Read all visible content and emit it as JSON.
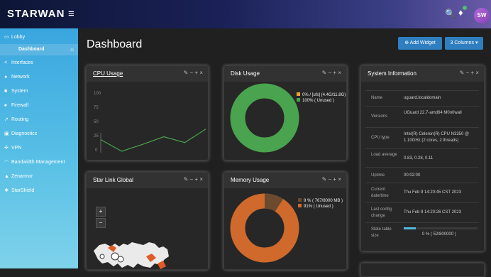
{
  "brand": {
    "name": "STARWAN",
    "avatar_initials": "SW",
    "hamburger_icon": "menu-icon",
    "search_icon": "search-icon",
    "bell_icon": "bell-icon"
  },
  "sidebar": {
    "items": [
      {
        "label": "Lobby",
        "icon": "monitor-icon"
      },
      {
        "label": "Dashboard",
        "icon": "home-icon"
      },
      {
        "label": "Interfaces",
        "icon": "share-icon"
      },
      {
        "label": "Network",
        "icon": "globe-icon"
      },
      {
        "label": "System",
        "icon": "server-icon"
      },
      {
        "label": "Firewall",
        "icon": "flame-icon"
      },
      {
        "label": "Routing",
        "icon": "route-icon"
      },
      {
        "label": "Diagnostics",
        "icon": "medkit-icon"
      },
      {
        "label": "VPN",
        "icon": "vpn-icon"
      },
      {
        "label": "Bandwidth Management",
        "icon": "gauge-icon"
      },
      {
        "label": "Zenarmor",
        "icon": "zenarmor-icon"
      },
      {
        "label": "StarShield",
        "icon": "shield-icon"
      }
    ]
  },
  "header": {
    "title": "Dashboard",
    "add_widget": "Add Widget",
    "columns": "3 Columns"
  },
  "widget_controls": "✎ − + ×",
  "cpu": {
    "title": "CPU Usage",
    "yticks": [
      "100",
      "75",
      "50",
      "25",
      "0"
    ],
    "values": [
      20,
      0,
      12,
      25,
      15,
      38
    ]
  },
  "disk": {
    "title": "Disk Usage",
    "legend": [
      "0% / [ufs] (4.4G/11.8G)",
      "100% ( Unused )"
    ],
    "used_pct": 0,
    "colors": {
      "used": "#f0a030",
      "unused": "#4aa34e"
    }
  },
  "sysinfo": {
    "title": "System Information",
    "rows": [
      {
        "k": "Name",
        "v": "uguard.localdomain"
      },
      {
        "k": "Versions",
        "v": "UGuard 22.7-amd64 M0n0wall"
      },
      {
        "k": "CPU type",
        "v": "Intel(R) Celeron(R) CPU N3350 @ 1.10GHz (2 cores, 2 threads)"
      },
      {
        "k": "Load average",
        "v": "0.83, 0.28, 0.11"
      },
      {
        "k": "Uptime",
        "v": "00:02:00"
      },
      {
        "k": "Current date/time",
        "v": "Thu Feb 9 14:20:45 CST 2023"
      },
      {
        "k": "Last config change",
        "v": "Thu Feb 9 14:20:26 CST 2023"
      },
      {
        "k": "State table size",
        "v": "0 % ( 52/800000 )"
      }
    ]
  },
  "starlink": {
    "title": "Star Link Global",
    "zoom_in": "+",
    "zoom_out": "−"
  },
  "memory": {
    "title": "Memory Usage",
    "legend": [
      "9 % ( 767/8000 MB )",
      "91% ( Unused )"
    ],
    "used_pct": 9,
    "colors": {
      "used": "#6b4a30",
      "unused": "#d06a2c"
    }
  }
}
